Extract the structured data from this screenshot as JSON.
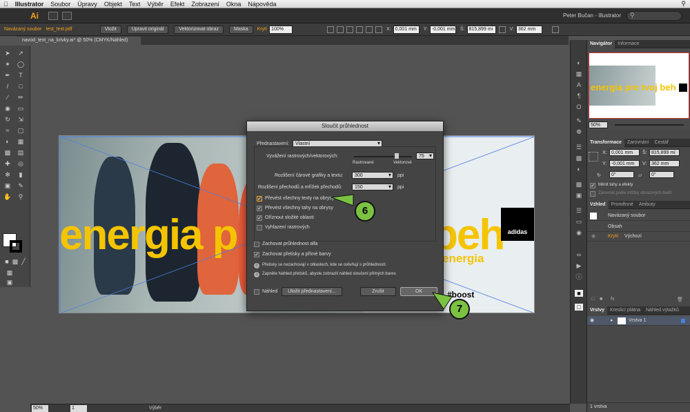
{
  "menubar": {
    "app": "Illustrator",
    "items": [
      "Soubor",
      "Úpravy",
      "Objekt",
      "Text",
      "Výběr",
      "Efekt",
      "Zobrazení",
      "Okna",
      "Nápověda"
    ]
  },
  "appbar": {
    "logo": "Ai",
    "user": "Peter Bučan - Illustrator"
  },
  "controlbar": {
    "linked": "Navázaný soubor",
    "filename": "test_text.pdf",
    "btn_embed": "Vložit",
    "btn_edit": "Upravit originál",
    "btn_vectorize": "Vektorizovat obraz",
    "btn_mask": "Maska",
    "opacity_label": "Krytí",
    "opacity_value": "100%",
    "x_label": "X:",
    "x_value": "0,001 mm",
    "y_label": "Y:",
    "y_value": "-0,001 mm",
    "w_label": "Š:",
    "w_value": "815,899 mi",
    "h_label": "V:",
    "h_value": "362 mm"
  },
  "document": {
    "tab": "navod_text_na_krivky.ai* @ 50% (CMYK/Náhled)"
  },
  "artwork": {
    "headline_left": "energia p",
    "headline_right": "beh",
    "subline": "energia",
    "brand": "adidas",
    "hashtag": "#boost"
  },
  "dialog": {
    "title": "Sloučit průhlednost",
    "preset_label": "Přednastavení:",
    "preset_value": "Vlastní",
    "balance_label": "Vyvážení rastrových/vektorových:",
    "balance_value": "75",
    "raster_label": "Rastrované",
    "vector_label": "Vektorové",
    "lineart_label": "Rozlišení čárové grafiky a textu:",
    "lineart_value": "300",
    "lineart_unit": "ppi",
    "gradient_label": "Rozlišení přechodů a mřížek přechodů:",
    "gradient_value": "150",
    "gradient_unit": "ppi",
    "checkboxes": [
      {
        "label": "Převést všechny texty na obrysy",
        "checked": true
      },
      {
        "label": "Převést všechny tahy na obrysy",
        "checked": true
      },
      {
        "label": "Oříznout složité oblasti",
        "checked": true
      },
      {
        "label": "Vyhlazení rastrových",
        "checked": false
      }
    ],
    "keep_alpha": "Zachovat průhlednost alfa",
    "keep_overprint": "Zachovat přetisky a přímé barvy",
    "info1": "Přetisky se nezachovají v oblastech, kde se ovlivňují s průhledností.",
    "info2": "Zapněte Náhled přetisků, abyste zobrazili náhled sloučení přímých barev.",
    "preview_label": "Náhled",
    "save_preset": "Uložit přednastavení...",
    "cancel": "Zrušit",
    "ok": "OK"
  },
  "callouts": [
    "6",
    "7"
  ],
  "panels": {
    "navigator_tabs": [
      "Navigátor",
      "Informace"
    ],
    "zoom": "50%",
    "transform_tabs": [
      "Transformace",
      "Zarovnání",
      "Cestář"
    ],
    "tx": "0,001 mm",
    "ty": "-0,001 mm",
    "tw": "815,899 mi",
    "th": "362 mm",
    "rot": "0°",
    "shear": "0°",
    "scale_strokes": "Měnit tahy a efekty",
    "align_pixel": "Zarovnat podle mřížky obrazových bodů",
    "appearance_tabs": [
      "Vzhled",
      "Proměnné",
      "Atributy"
    ],
    "app_object": "Navázaný soubor",
    "app_content": "Obsah",
    "app_opacity_label": "Krytí:",
    "app_opacity_value": "Výchozí",
    "layers_tabs": [
      "Vrstvy",
      "Kreslicí plátna",
      "Náhled výtažků"
    ],
    "layer_name": "Vrstva 1",
    "layer_count": "1 vrstva"
  },
  "statusbar": {
    "zoom": "50%",
    "page": "1",
    "tool": "Výběr"
  }
}
